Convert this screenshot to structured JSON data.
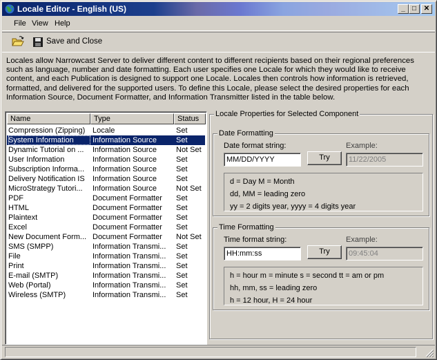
{
  "window": {
    "title": "Locale Editor - English (US)"
  },
  "menu": [
    "File",
    "View",
    "Help"
  ],
  "toolbar": {
    "save_close_label": "Save and Close"
  },
  "description": "Locales allow Narrowcast Server to deliver different content to different recipients based on their regional preferences such as language, number and date formatting. Each user specifies one Locale for which they would like to receive content, and each Publication is designed to support one Locale. Locales then controls how information is retrieved, formatted, and delivered for the supported users. To define this Locale, please select the desired properties for each Information Source, Document Formatter, and Information Transmitter listed in the table below.",
  "list": {
    "columns": [
      "Name",
      "Type",
      "Status"
    ],
    "rows": [
      {
        "name": "Compression (Zipping)",
        "type": "Locale",
        "status": "Set"
      },
      {
        "name": "System Information",
        "type": "Information Source",
        "status": "Set"
      },
      {
        "name": "Dynamic Tutorial on ...",
        "type": "Information Source",
        "status": "Not Set"
      },
      {
        "name": "User Information",
        "type": "Information Source",
        "status": "Set"
      },
      {
        "name": "Subscription Informa...",
        "type": "Information Source",
        "status": "Set"
      },
      {
        "name": "Delivery Notification IS",
        "type": "Information Source",
        "status": "Set"
      },
      {
        "name": "MicroStrategy Tutori...",
        "type": "Information Source",
        "status": "Not Set"
      },
      {
        "name": "PDF",
        "type": "Document Formatter",
        "status": "Set"
      },
      {
        "name": "HTML",
        "type": "Document Formatter",
        "status": "Set"
      },
      {
        "name": "Plaintext",
        "type": "Document Formatter",
        "status": "Set"
      },
      {
        "name": "Excel",
        "type": "Document Formatter",
        "status": "Set"
      },
      {
        "name": "New Document Form...",
        "type": "Document Formatter",
        "status": "Not Set"
      },
      {
        "name": "SMS (SMPP)",
        "type": "Information Transmi...",
        "status": "Set"
      },
      {
        "name": "File",
        "type": "Information Transmi...",
        "status": "Set"
      },
      {
        "name": "Print",
        "type": "Information Transmi...",
        "status": "Set"
      },
      {
        "name": "E-mail (SMTP)",
        "type": "Information Transmi...",
        "status": "Set"
      },
      {
        "name": "Web (Portal)",
        "type": "Information Transmi...",
        "status": "Set"
      },
      {
        "name": "Wireless (SMTP)",
        "type": "Information Transmi...",
        "status": "Set"
      }
    ],
    "selected_index": 1
  },
  "props": {
    "title": "Locale Properties for Selected Component",
    "date": {
      "group_label": "Date Formatting",
      "format_label": "Date format string:",
      "format_value": "MM/DD/YYYY",
      "try_label": "Try",
      "example_label": "Example:",
      "example_value": "11/22/2005",
      "help": [
        "d = Day   M = Month",
        "dd, MM = leading zero",
        "yy = 2 digits year, yyyy = 4 digits year"
      ]
    },
    "time": {
      "group_label": "Time Formatting",
      "format_label": "Time format string:",
      "format_value": "HH:mm:ss",
      "try_label": "Try",
      "example_label": "Example:",
      "example_value": "09:45:04",
      "help": [
        "h = hour     m = minute     s = second   tt = am or pm",
        "hh, mm, ss = leading zero",
        "h = 12 hour,  H = 24 hour"
      ]
    }
  }
}
